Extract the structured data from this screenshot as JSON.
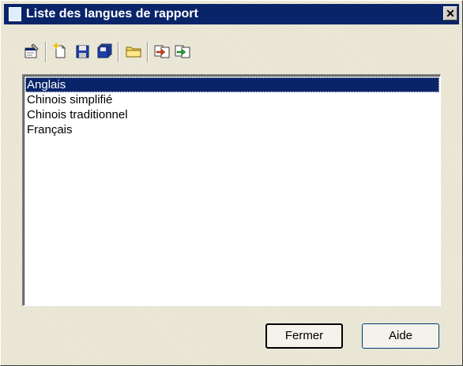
{
  "window": {
    "title": "Liste des langues de rapport",
    "close_label": "✕"
  },
  "toolbar": {
    "buttons": [
      {
        "icon": "properties-icon"
      },
      {
        "icon": "new-icon"
      },
      {
        "icon": "save-icon"
      },
      {
        "icon": "save-all-icon"
      },
      {
        "icon": "open-folder-icon"
      },
      {
        "icon": "import-icon"
      },
      {
        "icon": "export-icon"
      }
    ]
  },
  "list": {
    "items": [
      {
        "label": "Anglais",
        "selected": true
      },
      {
        "label": "Chinois simplifié",
        "selected": false
      },
      {
        "label": "Chinois traditionnel",
        "selected": false
      },
      {
        "label": "Français",
        "selected": false
      }
    ]
  },
  "buttons": {
    "close_label": "Fermer",
    "help_label": "Aide"
  },
  "colors": {
    "titlebar": "#0a246a",
    "selection": "#0a246a",
    "dialog_bg": "#ece9d8"
  }
}
